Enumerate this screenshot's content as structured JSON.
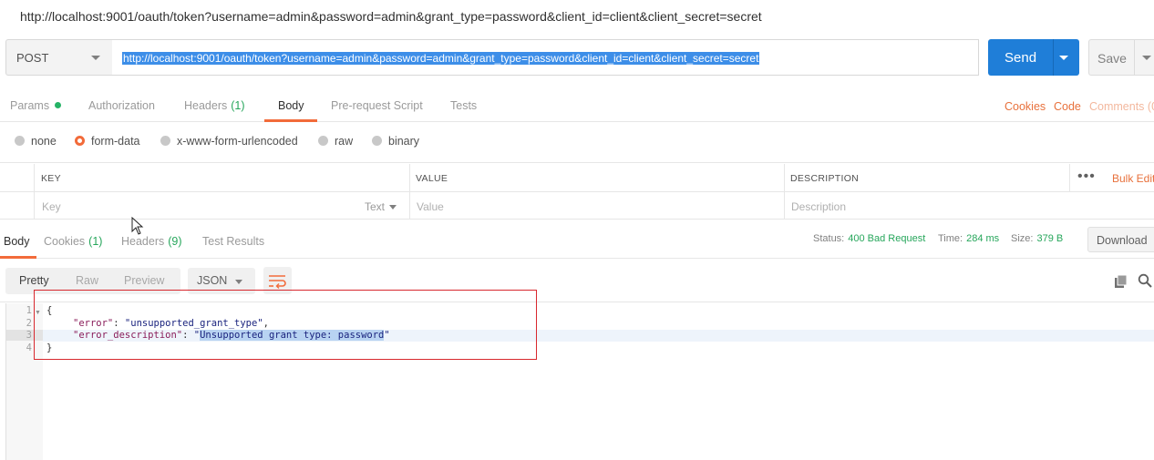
{
  "window": {
    "title": "http://localhost:9001/oauth/token?username=admin&password=admin&grant_type=password&client_id=client&client_secret=secret"
  },
  "request": {
    "method": "POST",
    "url": "http://localhost:9001/oauth/token?username=admin&password=admin&grant_type=password&client_id=client&client_secret=secret",
    "send_label": "Send",
    "save_label": "Save"
  },
  "request_tabs": {
    "params": "Params",
    "authorization": "Authorization",
    "headers": "Headers",
    "headers_count": "(1)",
    "body": "Body",
    "prerequest": "Pre-request Script",
    "tests": "Tests",
    "cookies": "Cookies",
    "code": "Code",
    "comments": "Comments (0"
  },
  "body_modes": {
    "none": "none",
    "form_data": "form-data",
    "urlencoded": "x-www-form-urlencoded",
    "raw": "raw",
    "binary": "binary",
    "selected": "form-data"
  },
  "kv_table": {
    "headers": {
      "key": "KEY",
      "value": "VALUE",
      "description": "DESCRIPTION"
    },
    "bulk_edit": "Bulk Edit",
    "placeholders": {
      "key": "Key",
      "value": "Value",
      "description": "Description"
    },
    "type": "Text"
  },
  "response_tabs": {
    "body": "Body",
    "cookies": "Cookies",
    "cookies_count": "(1)",
    "headers": "Headers",
    "headers_count": "(9)",
    "test_results": "Test Results"
  },
  "response_status": {
    "status_label": "Status:",
    "status_value": "400 Bad Request",
    "time_label": "Time:",
    "time_value": "284 ms",
    "size_label": "Size:",
    "size_value": "379 B",
    "download": "Download"
  },
  "response_view": {
    "pretty": "Pretty",
    "raw": "Raw",
    "preview": "Preview",
    "format": "JSON"
  },
  "code": {
    "line_numbers": [
      "1",
      "2",
      "3",
      "4"
    ],
    "open_brace": "{",
    "close_brace": "}",
    "error_key": "\"error\"",
    "error_value": "\"unsupported_grant_type\"",
    "desc_key": "\"error_description\"",
    "desc_value_open_quote": "\"",
    "desc_value_text": "Unsupported grant type: password",
    "desc_value_close_quote": "\"",
    "colon": ": ",
    "comma": ","
  },
  "colors": {
    "accent_orange": "#f26b3a",
    "send_blue": "#1f7ed8",
    "status_green": "#26a65b",
    "annotation_red": "#d8282e"
  }
}
